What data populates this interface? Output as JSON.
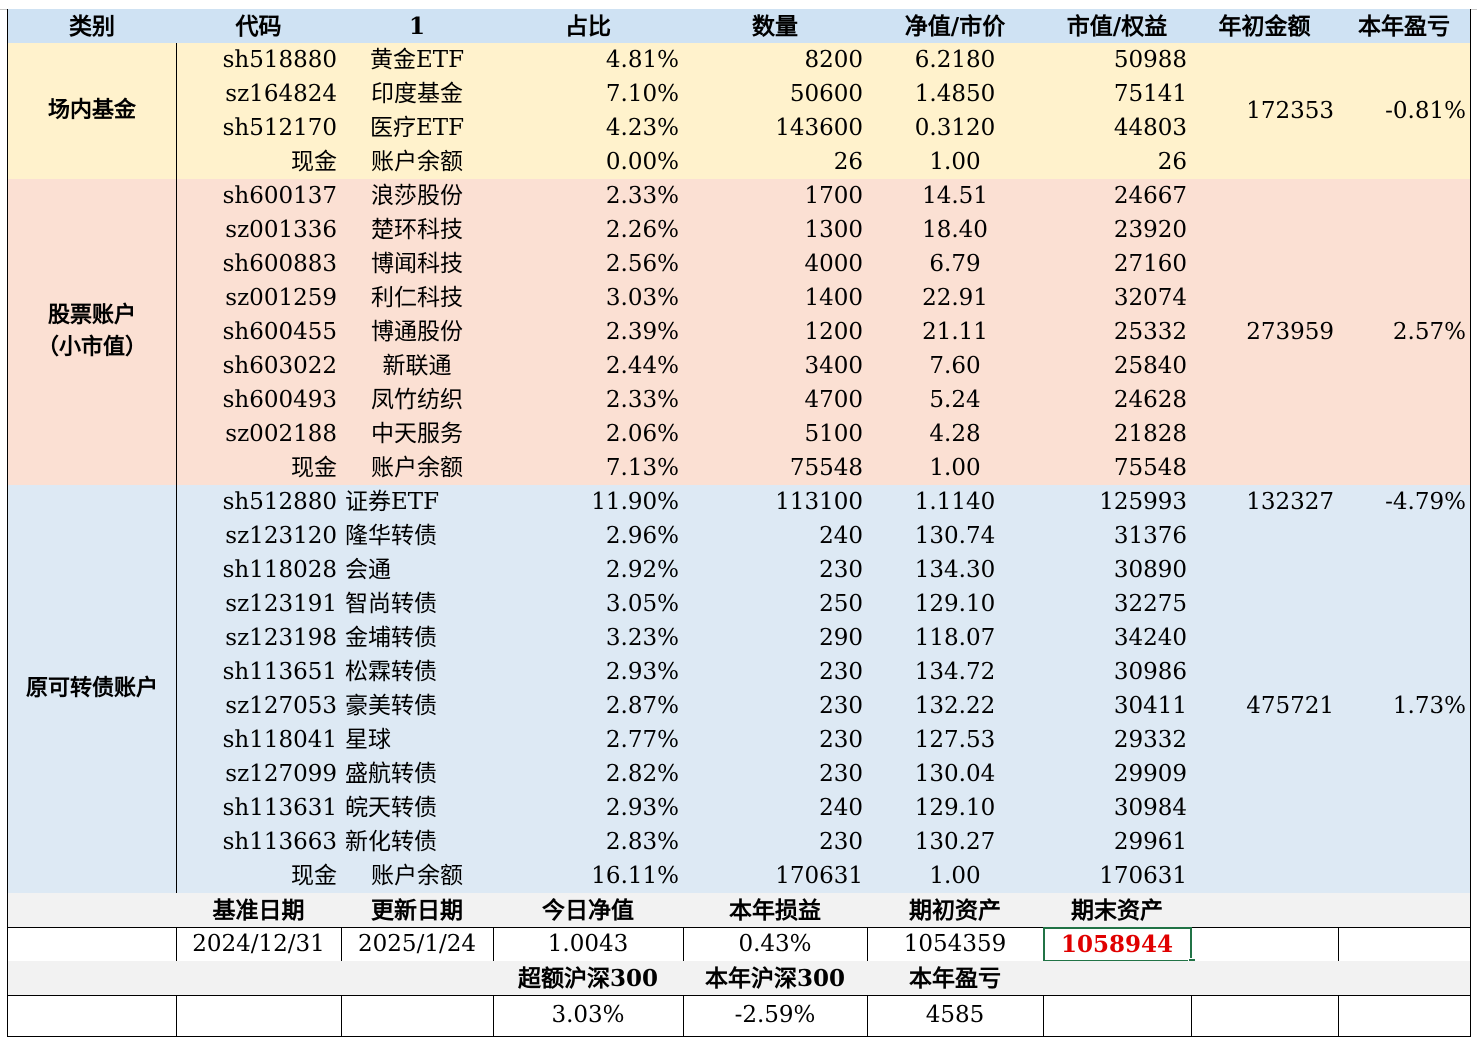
{
  "colors": {
    "header": "#cfe2f3",
    "fund": "#fff2cc",
    "stock": "#fbe0d3",
    "bond": "#dde9f4",
    "highlight_text": "#e00000"
  },
  "header": [
    "类别",
    "代码",
    "1",
    "占比",
    "数量",
    "净值/市价",
    "市值/权益",
    "年初金额",
    "本年盈亏"
  ],
  "groups": [
    {
      "category": "场内基金",
      "rows": [
        {
          "code": "sh518880",
          "name": "黄金ETF",
          "pct": "4.81%",
          "qty": "8200",
          "price": "6.2180",
          "value": "50988"
        },
        {
          "code": "sz164824",
          "name": "印度基金",
          "pct": "7.10%",
          "qty": "50600",
          "price": "1.4850",
          "value": "75141"
        },
        {
          "code": "sh512170",
          "name": "医疗ETF",
          "pct": "4.23%",
          "qty": "143600",
          "price": "0.3120",
          "value": "44803"
        },
        {
          "code": "现金",
          "name": "账户余额",
          "pct": "0.00%",
          "qty": "26",
          "price": "1.00",
          "value": "26"
        }
      ],
      "start_amount": "172353",
      "ytd_pl": "-0.81%"
    },
    {
      "category": "股票账户（小市值）",
      "rows": [
        {
          "code": "sh600137",
          "name": "浪莎股份",
          "pct": "2.33%",
          "qty": "1700",
          "price": "14.51",
          "value": "24667"
        },
        {
          "code": "sz001336",
          "name": "楚环科技",
          "pct": "2.26%",
          "qty": "1300",
          "price": "18.40",
          "value": "23920"
        },
        {
          "code": "sh600883",
          "name": "博闻科技",
          "pct": "2.56%",
          "qty": "4000",
          "price": "6.79",
          "value": "27160"
        },
        {
          "code": "sz001259",
          "name": "利仁科技",
          "pct": "3.03%",
          "qty": "1400",
          "price": "22.91",
          "value": "32074"
        },
        {
          "code": "sh600455",
          "name": "博通股份",
          "pct": "2.39%",
          "qty": "1200",
          "price": "21.11",
          "value": "25332"
        },
        {
          "code": "sh603022",
          "name": "新联通",
          "pct": "2.44%",
          "qty": "3400",
          "price": "7.60",
          "value": "25840"
        },
        {
          "code": "sh600493",
          "name": "凤竹纺织",
          "pct": "2.33%",
          "qty": "4700",
          "price": "5.24",
          "value": "24628"
        },
        {
          "code": "sz002188",
          "name": "中天服务",
          "pct": "2.06%",
          "qty": "5100",
          "price": "4.28",
          "value": "21828"
        },
        {
          "code": "现金",
          "name": "账户余额",
          "pct": "7.13%",
          "qty": "75548",
          "price": "1.00",
          "value": "75548"
        }
      ],
      "start_amount": "273959",
      "ytd_pl": "2.57%"
    },
    {
      "category": "原可转债账户",
      "rows": [
        {
          "code": "sh512880",
          "name": "证券ETF",
          "pct": "11.90%",
          "qty": "113100",
          "price": "1.1140",
          "value": "125993"
        },
        {
          "code": "sz123120",
          "name": "隆华转债",
          "pct": "2.96%",
          "qty": "240",
          "price": "130.74",
          "value": "31376"
        },
        {
          "code": "sh118028",
          "name": "会通",
          "pct": "2.92%",
          "qty": "230",
          "price": "134.30",
          "value": "30890"
        },
        {
          "code": "sz123191",
          "name": "智尚转债",
          "pct": "3.05%",
          "qty": "250",
          "price": "129.10",
          "value": "32275"
        },
        {
          "code": "sz123198",
          "name": "金埔转债",
          "pct": "3.23%",
          "qty": "290",
          "price": "118.07",
          "value": "34240"
        },
        {
          "code": "sh113651",
          "name": "松霖转债",
          "pct": "2.93%",
          "qty": "230",
          "price": "134.72",
          "value": "30986"
        },
        {
          "code": "sz127053",
          "name": "豪美转债",
          "pct": "2.87%",
          "qty": "230",
          "price": "132.22",
          "value": "30411"
        },
        {
          "code": "sh118041",
          "name": "星球",
          "pct": "2.77%",
          "qty": "230",
          "price": "127.53",
          "value": "29332"
        },
        {
          "code": "sz127099",
          "name": "盛航转债",
          "pct": "2.82%",
          "qty": "230",
          "price": "130.04",
          "value": "29909"
        },
        {
          "code": "sh113631",
          "name": "皖天转债",
          "pct": "2.93%",
          "qty": "240",
          "price": "129.10",
          "value": "30984"
        },
        {
          "code": "sh113663",
          "name": "新化转债",
          "pct": "2.83%",
          "qty": "230",
          "price": "130.27",
          "value": "29961"
        },
        {
          "code": "现金",
          "name": "账户余额",
          "pct": "16.11%",
          "qty": "170631",
          "price": "1.00",
          "value": "170631"
        }
      ],
      "etf_start_amount": "132327",
      "etf_ytd_pl": "-4.79%",
      "start_amount": "475721",
      "ytd_pl": "1.73%"
    }
  ],
  "summary": {
    "labels": [
      "基准日期",
      "更新日期",
      "今日净值",
      "本年损益",
      "期初资产",
      "期末资产"
    ],
    "values": [
      "2024/12/31",
      "2025/1/24",
      "1.0043",
      "0.43%",
      "1054359",
      "1058944"
    ],
    "labels2": [
      "超额沪深300",
      "本年沪深300",
      "本年盈亏"
    ],
    "values2": [
      "3.03%",
      "-2.59%",
      "4585"
    ]
  }
}
